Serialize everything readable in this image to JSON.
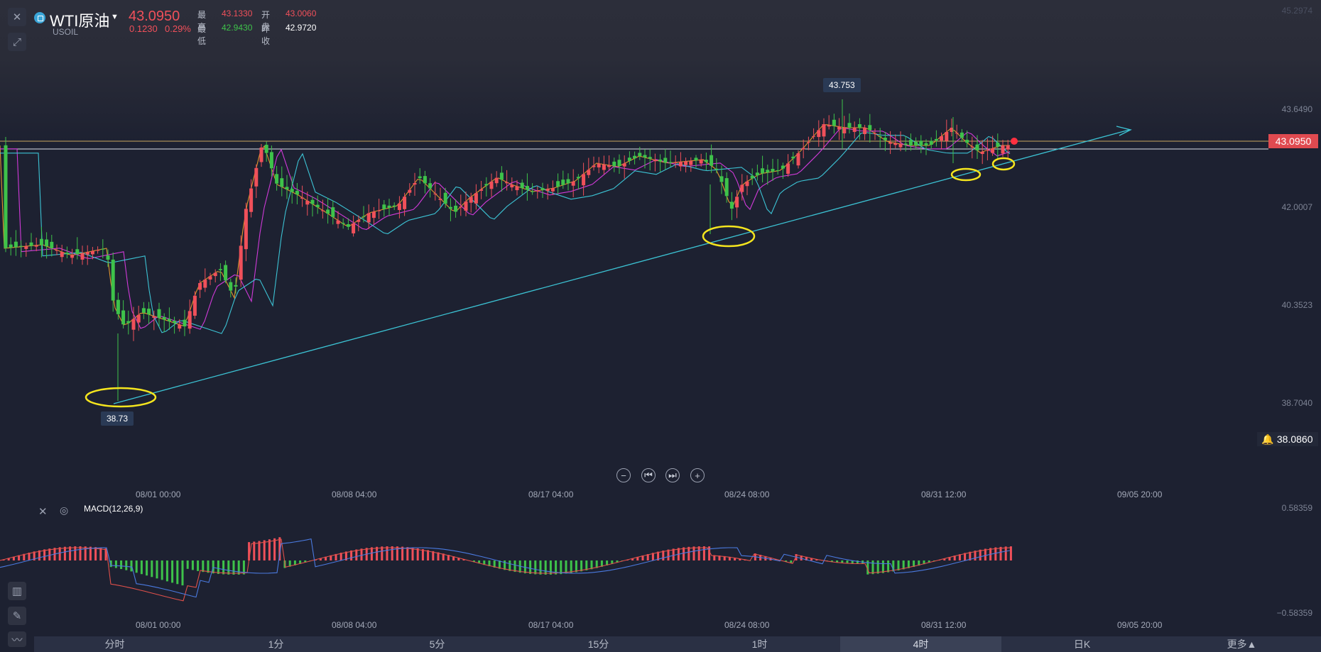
{
  "symbol": {
    "name": "WTI原油",
    "code": "USOIL",
    "price": "43.0950",
    "change": "0.1230",
    "change_pct": "0.29%"
  },
  "stats": {
    "high_label": "最高",
    "high": "43.1330",
    "open_label": "开盘",
    "open": "43.0060",
    "low_label": "最低",
    "low": "42.9430",
    "prev_label": "昨收",
    "prev": "42.9720"
  },
  "price_axis": [
    "43.6490",
    "42.0007",
    "40.3523",
    "38.7040"
  ],
  "price_axis_top": "45.2974",
  "current_price_tag": "43.0950",
  "alert_price": "38.0860",
  "annotations": {
    "high_bubble": "43.753",
    "low_bubble": "38.73"
  },
  "x_axis": [
    "08/01 00:00",
    "08/08 04:00",
    "08/17 04:00",
    "08/24 08:00",
    "08/31 12:00",
    "09/05 20:00"
  ],
  "macd": {
    "label": "MACD(12,26,9)",
    "axis_top": "0.58359",
    "axis_bottom": "−0.58359"
  },
  "timeframes": [
    {
      "label": "分时",
      "active": false
    },
    {
      "label": "1分",
      "active": false
    },
    {
      "label": "5分",
      "active": false
    },
    {
      "label": "15分",
      "active": false
    },
    {
      "label": "1时",
      "active": false
    },
    {
      "label": "4时",
      "active": true
    },
    {
      "label": "日K",
      "active": false
    },
    {
      "label": "更多▲",
      "active": false
    }
  ],
  "colors": {
    "up": "#f0505a",
    "down": "#3ec24a",
    "trend": "#3cc3d4",
    "highlight": "#f5e51e",
    "background": "#1d2131"
  },
  "icons": [
    "close-icon",
    "draw-tool-icon",
    "zoom-out-icon",
    "step-back-icon",
    "step-forward-icon",
    "zoom-in-icon",
    "bell-icon",
    "settings-icon",
    "indicator-icon",
    "pen-icon",
    "line-chart-icon"
  ]
}
